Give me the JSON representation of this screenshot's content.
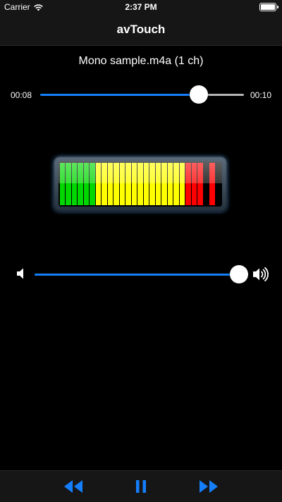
{
  "status_bar": {
    "carrier": "Carrier",
    "time": "2:37 PM"
  },
  "nav": {
    "title": "avTouch"
  },
  "player": {
    "file_title": "Mono sample.m4a (1 ch)",
    "current_time": "00:08",
    "total_time": "00:10",
    "progress": 0.78
  },
  "meter": {
    "segments": 27,
    "level": 0.9,
    "peak": 0.98
  },
  "volume": {
    "level": 1.0
  },
  "toolbar": {
    "rewind": "rewind-icon",
    "pause": "pause-icon",
    "fast_forward": "fast-forward-icon"
  },
  "colors": {
    "accent": "#157efb",
    "track_remaining": "#b5b5b5",
    "meter_green": "#00d700",
    "meter_yellow": "#ffff00",
    "meter_red": "#ff0000"
  }
}
